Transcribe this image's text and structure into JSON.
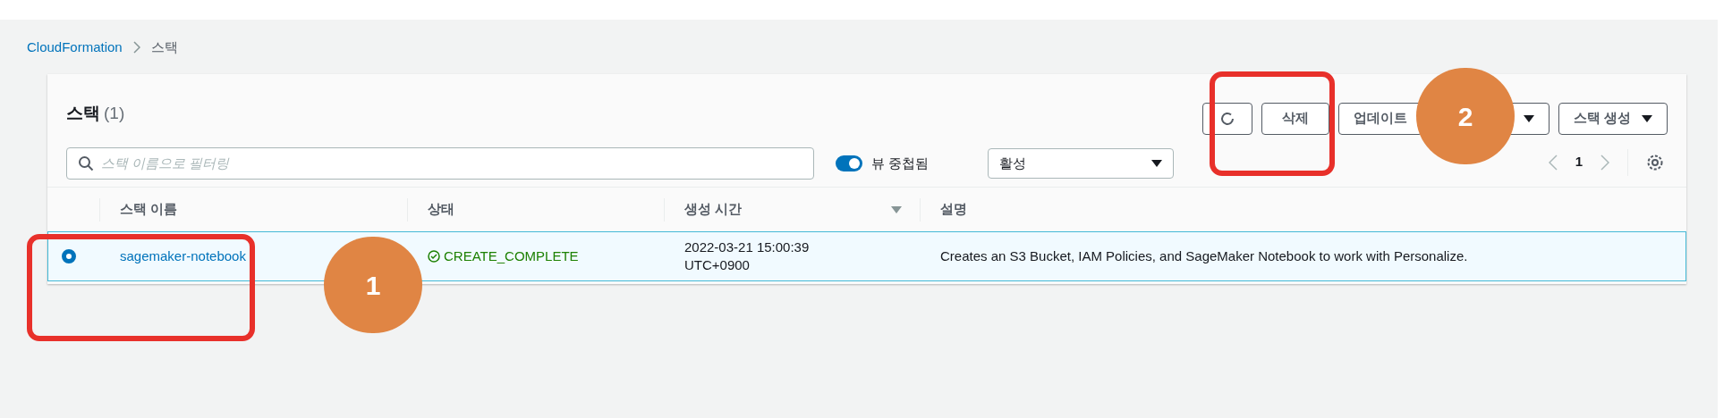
{
  "breadcrumb": [
    {
      "label": "CloudFormation",
      "kind": "link"
    },
    {
      "label": "스택",
      "kind": "current"
    }
  ],
  "panel": {
    "title": "스택",
    "count": "(1)",
    "search": {
      "placeholder": "스택 이름으로 필터링"
    },
    "nested_view": {
      "label": "뷰 중첩됨",
      "on": true
    },
    "status_filter": {
      "value": "활성"
    },
    "buttons": [
      {
        "kind": "icon"
      },
      {
        "kind": "text",
        "label": "삭제"
      },
      {
        "kind": "text",
        "label": "업데이트"
      },
      {
        "kind": "caret"
      },
      {
        "kind": "dropdown",
        "label": "스택 생성"
      }
    ],
    "pagination": {
      "page": "1"
    },
    "table": {
      "columns": [
        {
          "label": "스택 이름",
          "sorted": false
        },
        {
          "label": "상태",
          "sorted": false
        },
        {
          "label": "생성 시간",
          "sorted": true
        },
        {
          "label": "설명",
          "sorted": false
        }
      ],
      "rows": [
        {
          "selected": true,
          "name": "sagemaker-notebook",
          "status": "CREATE_COMPLETE",
          "created": [
            "2022-03-21 15:00:39",
            "UTC+0900"
          ],
          "description": "Creates an S3 Bucket, IAM Policies, and SageMaker Notebook to work with Personalize."
        }
      ]
    }
  },
  "annotations": [
    {
      "kind": "box",
      "number": "1"
    },
    {
      "kind": "box",
      "number": "2"
    }
  ]
}
